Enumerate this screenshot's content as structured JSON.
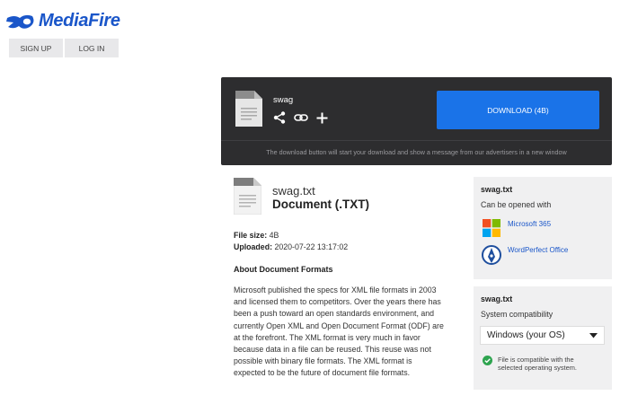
{
  "brand": {
    "name": "MediaFire"
  },
  "auth": {
    "signup": "SIGN UP",
    "login": "LOG IN"
  },
  "download": {
    "filename": "swag",
    "button_label": "DOWNLOAD (4B)",
    "note": "The download button will start your download and show a message from our advertisers in a new window"
  },
  "file": {
    "name": "swag.txt",
    "type": "Document (.TXT)",
    "size_label": "File size:",
    "size_value": "4B",
    "uploaded_label": "Uploaded:",
    "uploaded_value": "2020-07-22 13:17:02"
  },
  "about": {
    "title": "About Document Formats",
    "body": "Microsoft published the specs for XML file formats in 2003 and licensed them to competitors. Over the years there has been a push toward an open standards environment, and currently Open XML and Open Document Format (ODF) are at the forefront. The XML format is very much in favor because data in a file can be reused. This reuse was not possible with binary file formats. The XML format is expected to be the future of document file formats."
  },
  "open_with": {
    "filename": "swag.txt",
    "subtitle": "Can be opened with",
    "apps": [
      "Microsoft 365",
      "WordPerfect Office"
    ]
  },
  "compatibility": {
    "filename": "swag.txt",
    "subtitle": "System compatibility",
    "selected_os": "Windows (your OS)",
    "status": "File is compatible with the selected operating system."
  },
  "colors": {
    "accent": "#1a73e8",
    "brand": "#1a56c9",
    "panel": "#2d2d2f",
    "ok": "#2ea44f"
  }
}
